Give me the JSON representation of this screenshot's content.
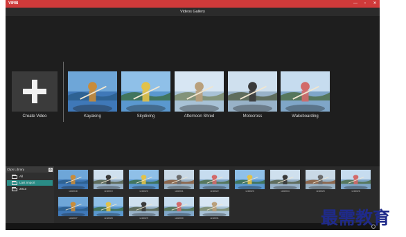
{
  "window": {
    "app_name": "VIRB",
    "controls": {
      "minimize": "—",
      "maximize": "▫",
      "close": "✕"
    }
  },
  "header": {
    "title": "Videos Gallery"
  },
  "gallery": {
    "create_label": "Create Video",
    "videos": [
      {
        "title": "Kayaking",
        "scene": "kayak"
      },
      {
        "title": "Skydiving",
        "scene": "sky"
      },
      {
        "title": "Afternoon Shred",
        "scene": "ramp"
      },
      {
        "title": "Motocross",
        "scene": "moto"
      },
      {
        "title": "Wakeboarding",
        "scene": "wake"
      }
    ]
  },
  "library": {
    "header": "Clips Library",
    "header_icon": "settings-icon",
    "items": [
      {
        "label": "All",
        "selected": false
      },
      {
        "label": "Last Import",
        "selected": true
      },
      {
        "label": "2013",
        "selected": false
      }
    ],
    "clips": [
      {
        "label": "virb0018",
        "scene": "kayak"
      },
      {
        "label": "virb0019",
        "scene": "moto"
      },
      {
        "label": "virb0020",
        "scene": "sky"
      },
      {
        "label": "virb0021",
        "scene": "road"
      },
      {
        "label": "virb0022",
        "scene": "wake"
      },
      {
        "label": "virb0023",
        "scene": "sky"
      },
      {
        "label": "virb0024",
        "scene": "moto"
      },
      {
        "label": "virb0025",
        "scene": "road"
      },
      {
        "label": "virb0026",
        "scene": "wake"
      },
      {
        "label": "virb0027",
        "scene": "kayak"
      },
      {
        "label": "virb0028",
        "scene": "sky"
      },
      {
        "label": "virb0029",
        "scene": "moto"
      },
      {
        "label": "virb0030",
        "scene": "wake"
      },
      {
        "label": "virb0031",
        "scene": "ramp"
      }
    ]
  },
  "watermark": {
    "text": "最需教育"
  },
  "colors": {
    "titlebar": "#cf3a3a",
    "selected": "#2a8c86",
    "background": "#1c1c1c"
  }
}
